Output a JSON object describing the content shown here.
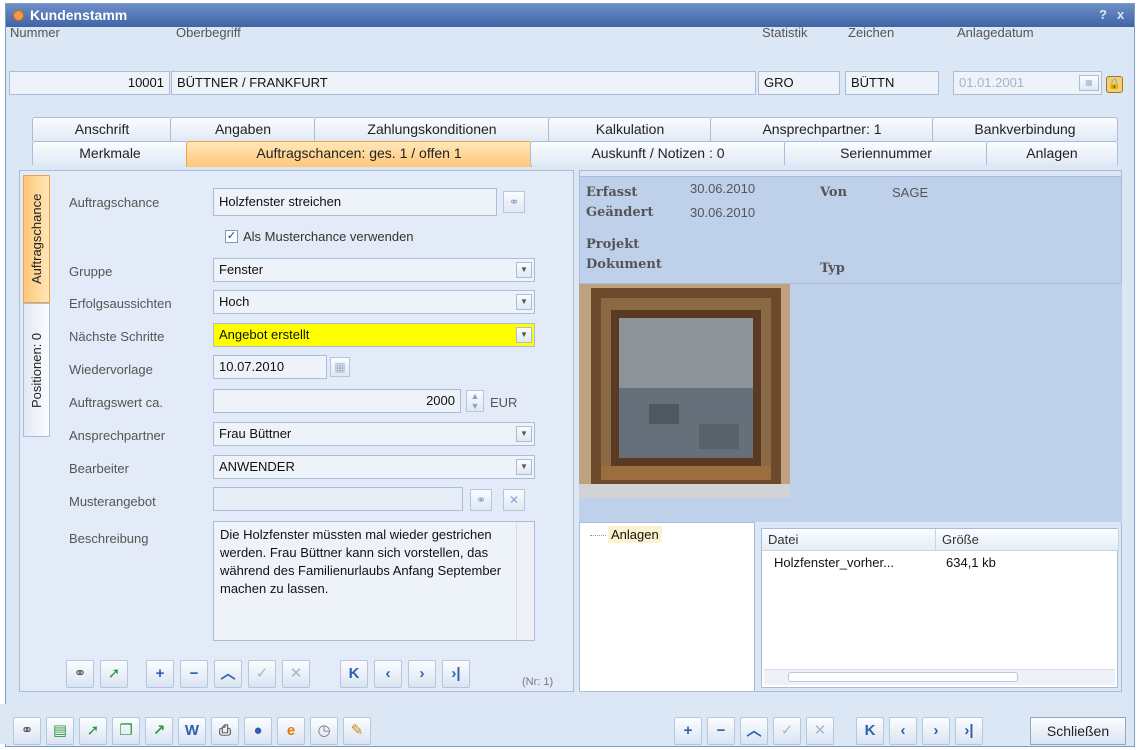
{
  "window": {
    "title": "Kundenstamm",
    "help": "?",
    "close": "x"
  },
  "header": {
    "nummer_label": "Nummer",
    "nummer_value": "10001",
    "oberbegriff_label": "Oberbegriff",
    "oberbegriff_value": "BÜTTNER / FRANKFURT",
    "statistik_label": "Statistik",
    "statistik_value": "GRO",
    "zeichen_label": "Zeichen",
    "zeichen_value": "BÜTTN",
    "anlagedatum_label": "Anlagedatum",
    "anlagedatum_value": "01.01.2001"
  },
  "tabs_row1": [
    "Anschrift",
    "Angaben",
    "Zahlungskonditionen",
    "Kalkulation",
    "Ansprechpartner: 1",
    "Bankverbindung"
  ],
  "tabs_row2": [
    "Merkmale",
    "Auftragschancen: ges. 1 / offen 1",
    "Auskunft / Notizen : 0",
    "Seriennummer",
    "Anlagen"
  ],
  "vertical_tabs": [
    "Auftragschance",
    "Positionen: 0"
  ],
  "form": {
    "auftragschance_label": "Auftragschance",
    "auftragschance_value": "Holzfenster streichen",
    "musterchance_label": "Als Musterchance verwenden",
    "gruppe_label": "Gruppe",
    "gruppe_value": "Fenster",
    "erfolg_label": "Erfolgsaussichten",
    "erfolg_value": "Hoch",
    "schritte_label": "Nächste Schritte",
    "schritte_value": "Angebot erstellt",
    "wiedervorlage_label": "Wiedervorlage",
    "wiedervorlage_value": "10.07.2010",
    "wert_label": "Auftragswert ca.",
    "wert_value": "2000",
    "wert_unit": "EUR",
    "ansprechpartner_label": "Ansprechpartner",
    "ansprechpartner_value": "Frau Büttner",
    "bearbeiter_label": "Bearbeiter",
    "bearbeiter_value": "ANWENDER",
    "musterangebot_label": "Musterangebot",
    "musterangebot_value": "",
    "beschreibung_label": "Beschreibung",
    "beschreibung_value": "Die Holzfenster müssten mal wieder gestrichen werden. Frau Büttner kann sich vorstellen, das während des Familienurlaubs Anfang September machen zu lassen.",
    "record_no": "(Nr: 1)"
  },
  "info": {
    "erfasst_label": "Erfasst",
    "erfasst_value": "30.06.2010",
    "von_label": "Von",
    "von_value": "SAGE",
    "geaendert_label": "Geändert",
    "geaendert_value": "30.06.2010",
    "projekt_label": "Projekt",
    "dokument_label": "Dokument",
    "typ_label": "Typ"
  },
  "attachments": {
    "tree_item": "Anlagen",
    "columns": [
      "Datei",
      "Größe"
    ],
    "rows": [
      {
        "datei": "Holzfenster_vorher...",
        "groesse": "634,1 kb"
      }
    ]
  },
  "bottom": {
    "close_label": "Schließen"
  }
}
